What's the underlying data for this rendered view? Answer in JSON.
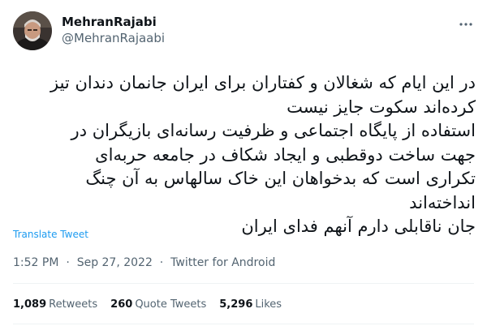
{
  "author": {
    "display_name": "MehranRajabi",
    "handle": "@MehranRajaabi"
  },
  "icons": {
    "avatar": "avatar-photo",
    "more": "more-horizontal-icon"
  },
  "tweet": {
    "lines": [
      "در این ایام که شغالان و کفتاران برای ایران جانمان دندان تیز",
      "کرده‌اند سکوت جایز نیست",
      "استفاده از پایگاه اجتماعی و ظرفیت رسانه‌ای بازیگران در",
      "جهت ساخت دوقطبی و ایجاد شکاف در جامعه حربه‌ای",
      "تکراری است که بدخواهان این خاک سالهاس به آن چنگ",
      "انداخته‌اند",
      "جان ناقابلی دارم آنهم فدای ایران"
    ],
    "translate_label": "Translate Tweet"
  },
  "meta": {
    "time": "1:52 PM",
    "separator": "·",
    "date": "Sep 27, 2022",
    "source": "Twitter for Android"
  },
  "stats": {
    "retweets": {
      "count": "1,089",
      "label": "Retweets"
    },
    "quotes": {
      "count": "260",
      "label": "Quote Tweets"
    },
    "likes": {
      "count": "5,296",
      "label": "Likes"
    }
  },
  "colors": {
    "link": "#1d9bf0",
    "secondary_text": "#536471",
    "primary_text": "#0f1419",
    "divider": "#eff3f4"
  }
}
